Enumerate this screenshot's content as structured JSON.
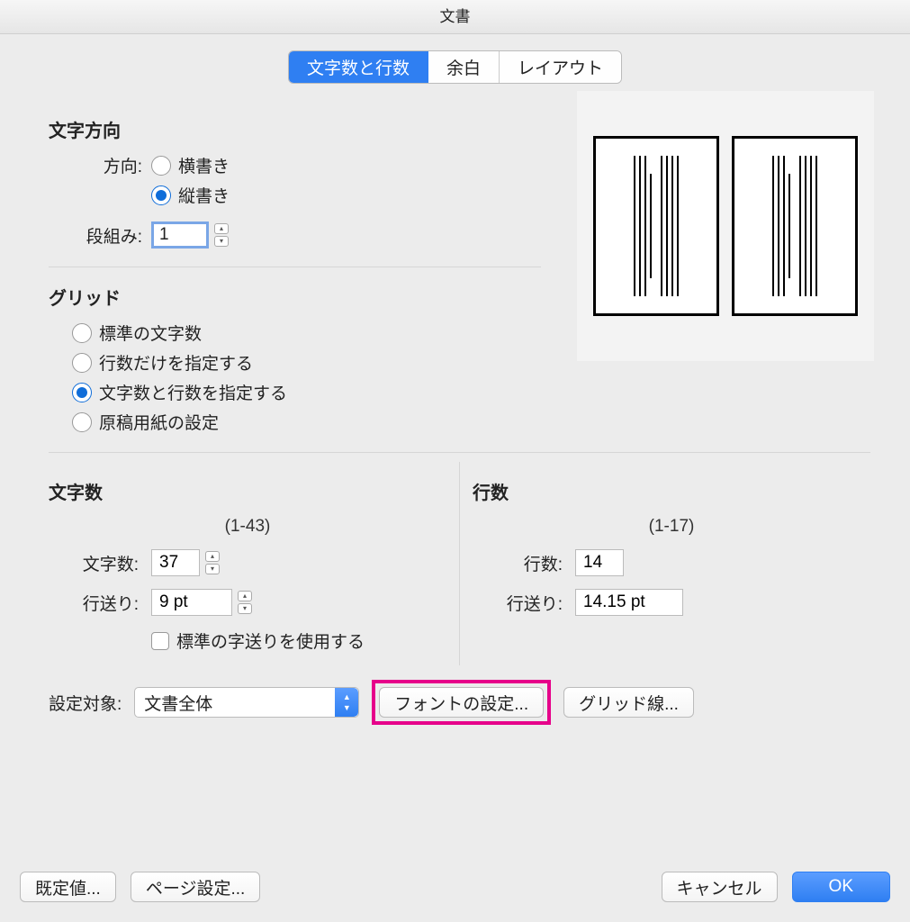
{
  "title": "文書",
  "tabs": {
    "chars_lines": "文字数と行数",
    "margin": "余白",
    "layout": "レイアウト"
  },
  "direction": {
    "section": "文字方向",
    "label": "方向:",
    "horizontal": "横書き",
    "vertical": "縦書き",
    "columns_label": "段組み:",
    "columns_value": "1"
  },
  "grid": {
    "section": "グリッド",
    "std_chars": "標準の文字数",
    "lines_only": "行数だけを指定する",
    "chars_and_lines": "文字数と行数を指定する",
    "manuscript": "原稿用紙の設定"
  },
  "chars": {
    "section": "文字数",
    "range": "(1-43)",
    "count_label": "文字数:",
    "count_value": "37",
    "pitch_label": "行送り:",
    "pitch_value": "9 pt",
    "use_std_label": "標準の字送りを使用する"
  },
  "lines": {
    "section": "行数",
    "range": "(1-17)",
    "count_label": "行数:",
    "count_value": "14",
    "pitch_label": "行送り:",
    "pitch_value": "14.15 pt"
  },
  "apply": {
    "label": "設定対象:",
    "value": "文書全体",
    "font_btn": "フォントの設定...",
    "gridlines_btn": "グリッド線..."
  },
  "footer": {
    "defaults": "既定値...",
    "page_setup": "ページ設定...",
    "cancel": "キャンセル",
    "ok": "OK"
  }
}
